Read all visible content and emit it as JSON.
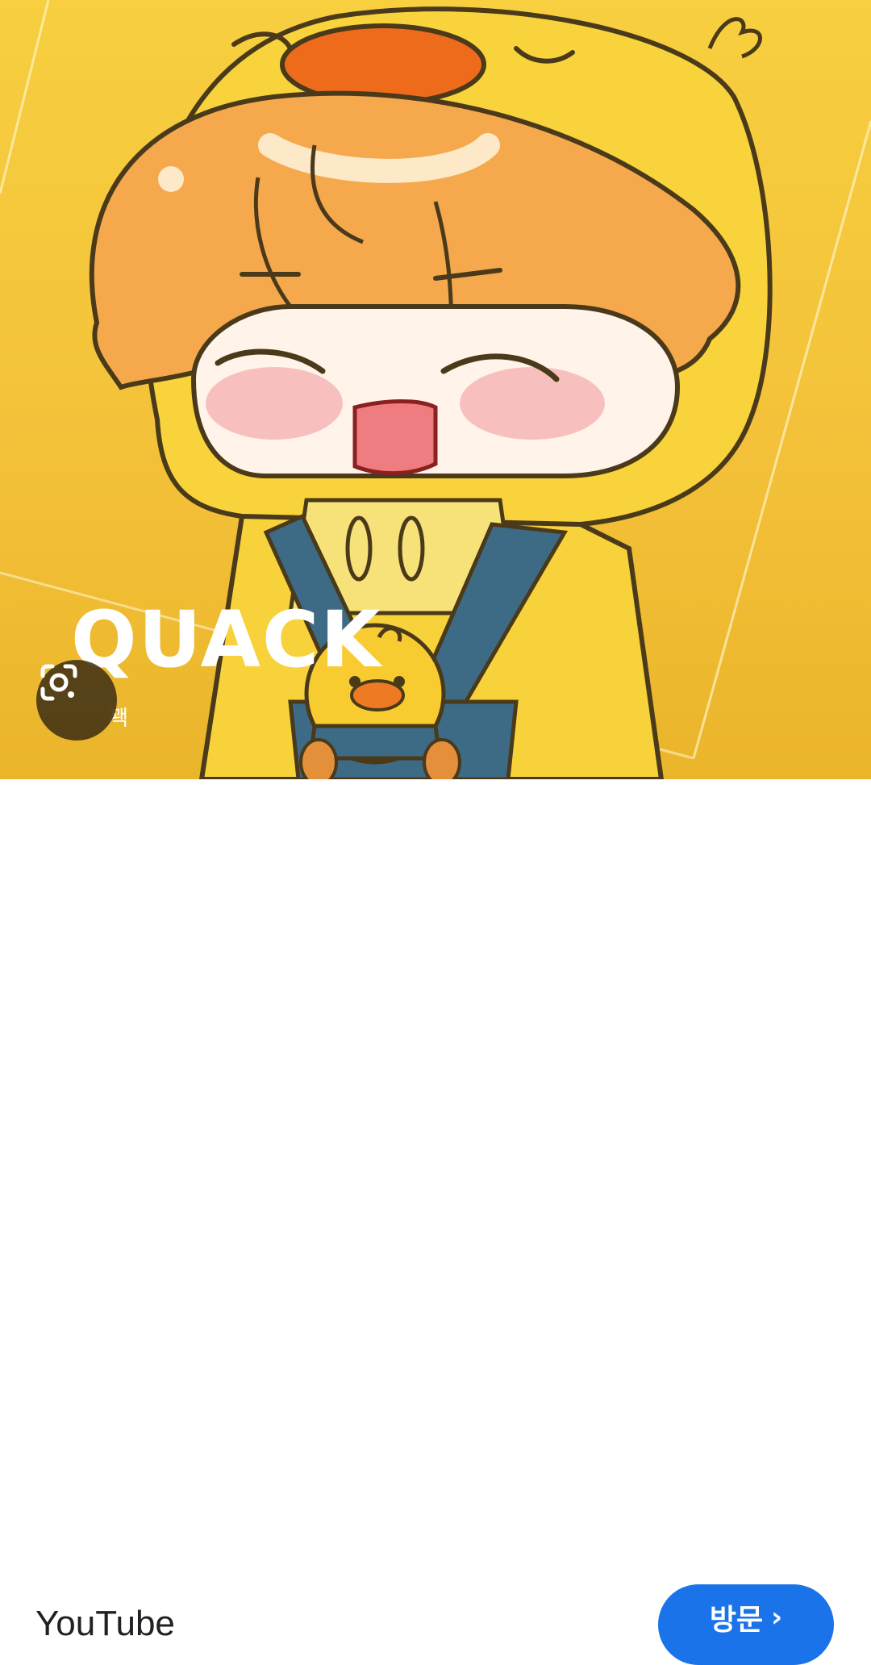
{
  "hero": {
    "image_description_icon": "chibi-duck-hood-character-illustration",
    "title": "QUACK",
    "subtitle": "꽥",
    "colors": {
      "background": "#f4c23a",
      "hair": "#f5a94c",
      "hood": "#f9d33c",
      "beak": "#ee6b1c",
      "strap": "#3d6a85"
    }
  },
  "lens": {
    "icon": "google-lens-icon"
  },
  "footer": {
    "source": "YouTube",
    "visit_label": "방문",
    "visit_icon": "chevron-right-icon",
    "accent": "#1a73e8"
  }
}
